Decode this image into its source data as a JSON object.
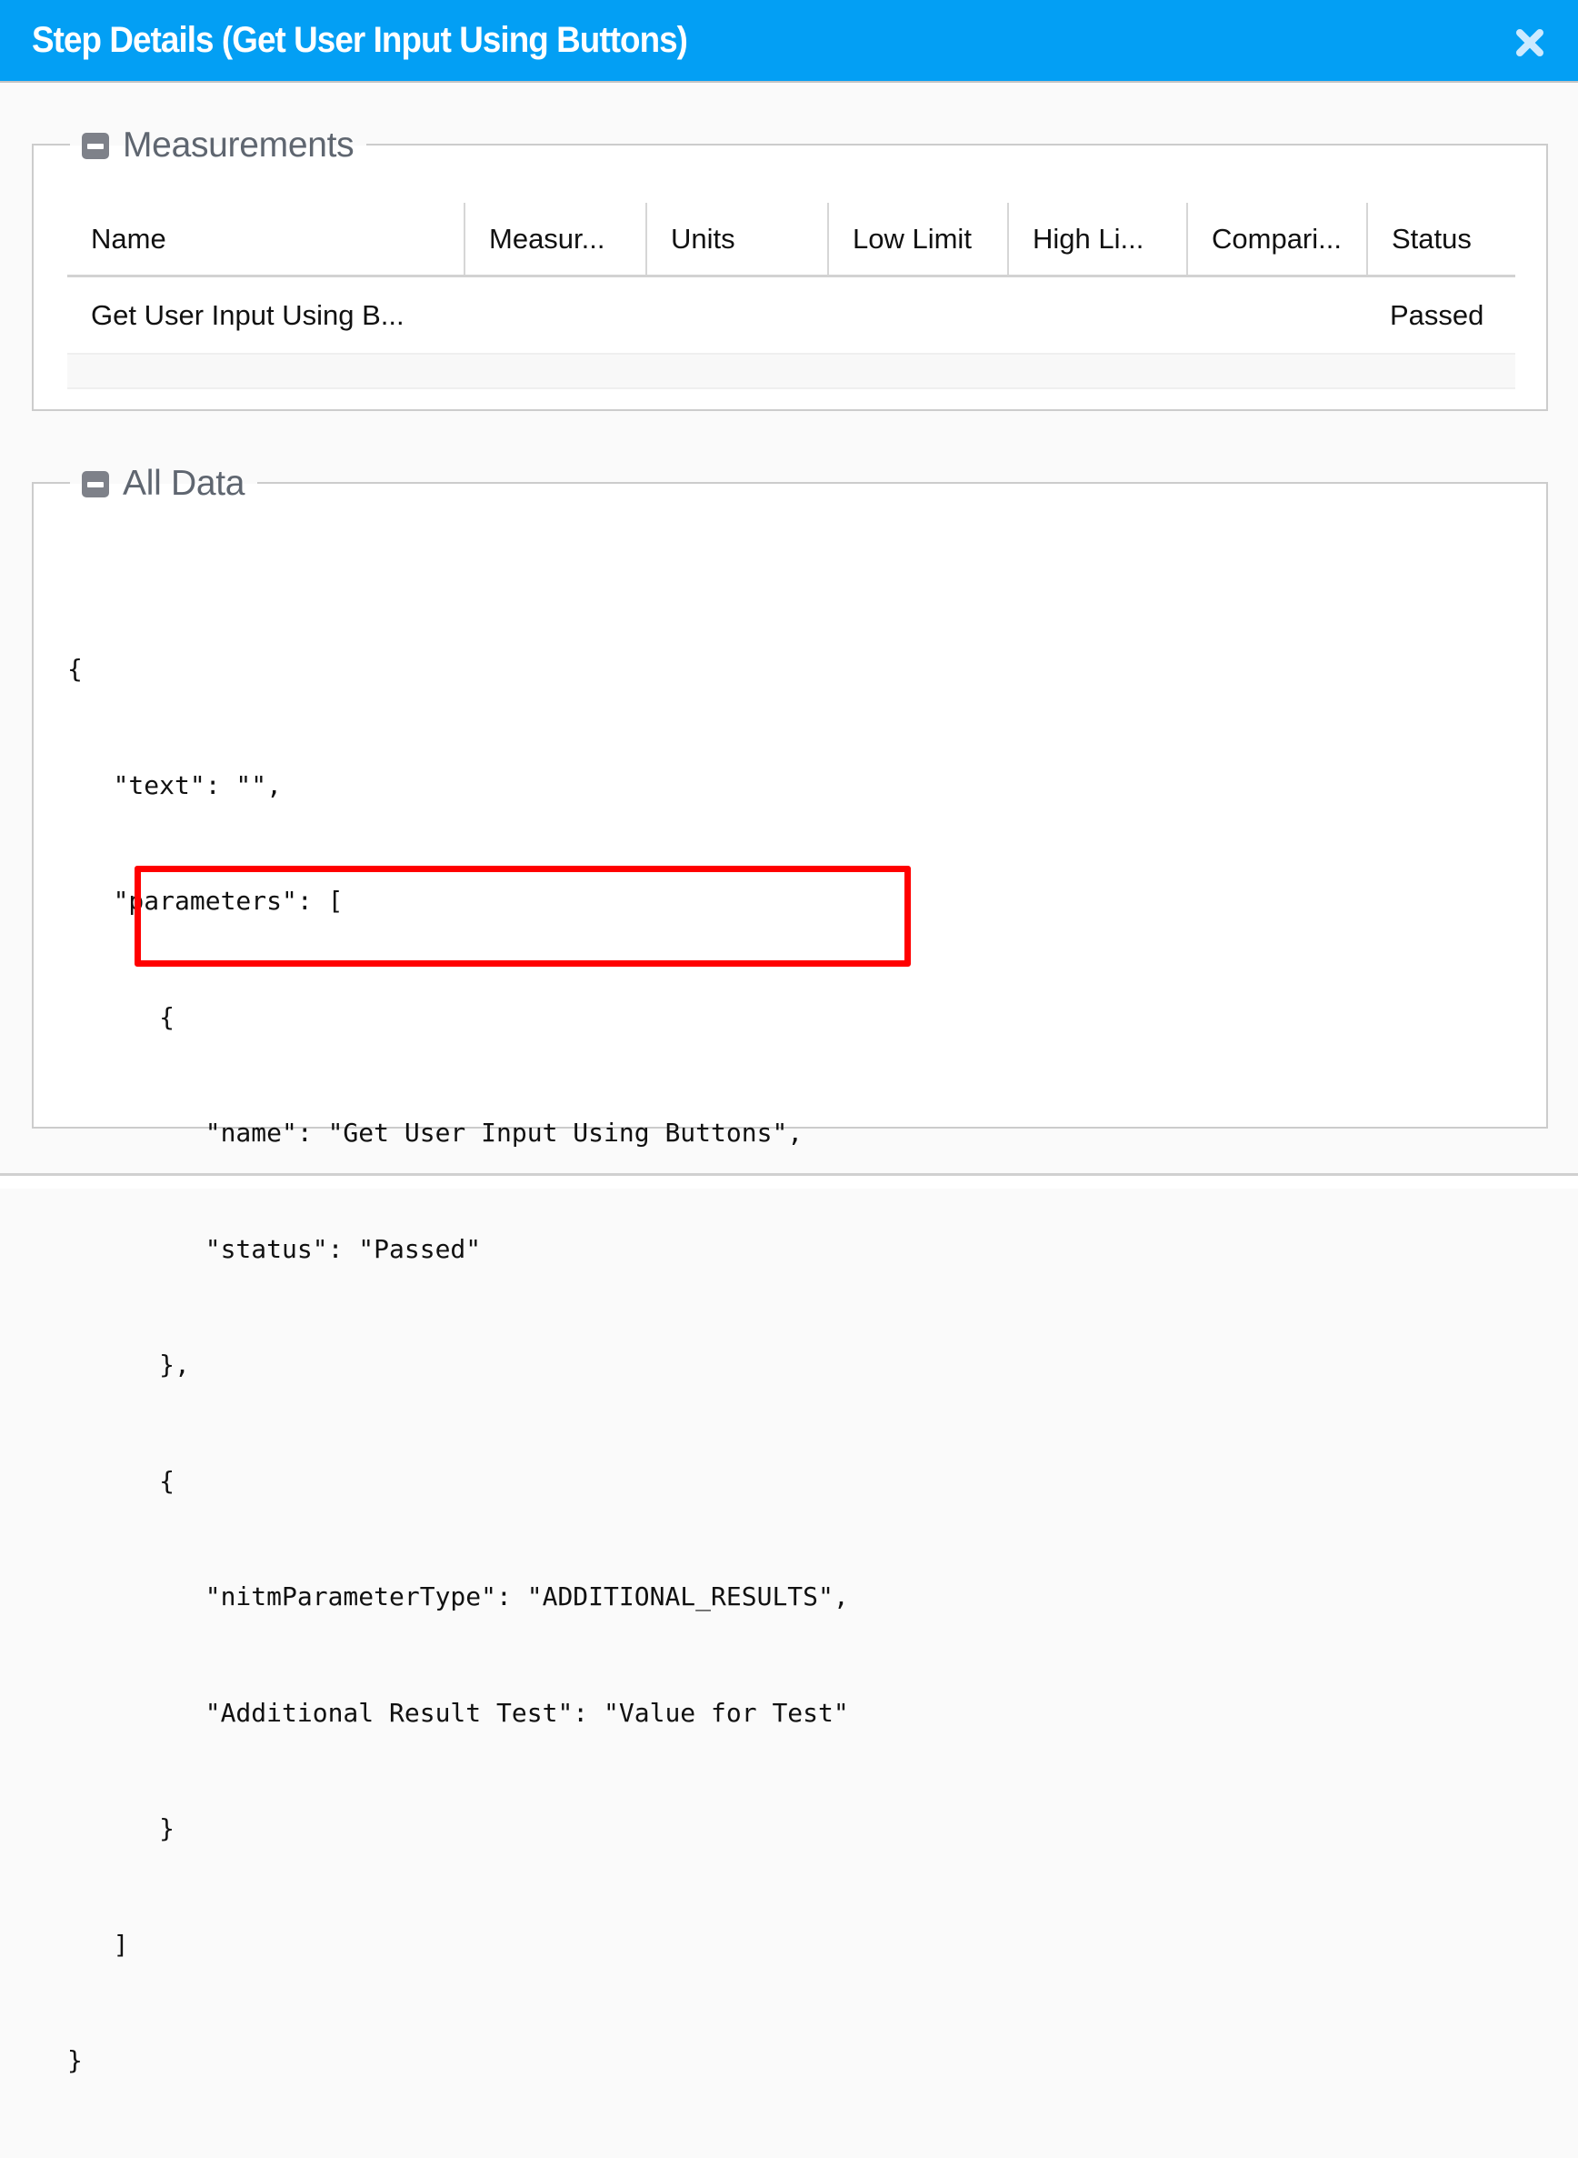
{
  "dialog": {
    "title": "Step Details (Get User Input Using Buttons)",
    "close_icon": "close-icon",
    "header_color": "#039ff4"
  },
  "measurements": {
    "legend": "Measurements",
    "collapse_icon": "minus-square-icon",
    "columns": [
      "Name",
      "Measur...",
      "Units",
      "Low Limit",
      "High Li...",
      "Compari...",
      "Status"
    ],
    "rows": [
      {
        "name": "Get User Input Using B...",
        "measurement": "",
        "units": "",
        "low_limit": "",
        "high_limit": "",
        "comparison": "",
        "status": "Passed"
      }
    ]
  },
  "all_data": {
    "legend": "All Data",
    "collapse_icon": "minus-square-icon",
    "code_lines": [
      "{",
      "   \"text\": \"\",",
      "   \"parameters\": [",
      "      {",
      "         \"name\": \"Get User Input Using Buttons\",",
      "         \"status\": \"Passed\"",
      "      },",
      "      {",
      "         \"nitmParameterType\": \"ADDITIONAL_RESULTS\",",
      "         \"Additional Result Test\": \"Value for Test\"",
      "      }",
      "   ]",
      "}"
    ],
    "highlight_color": "#ff0000"
  }
}
